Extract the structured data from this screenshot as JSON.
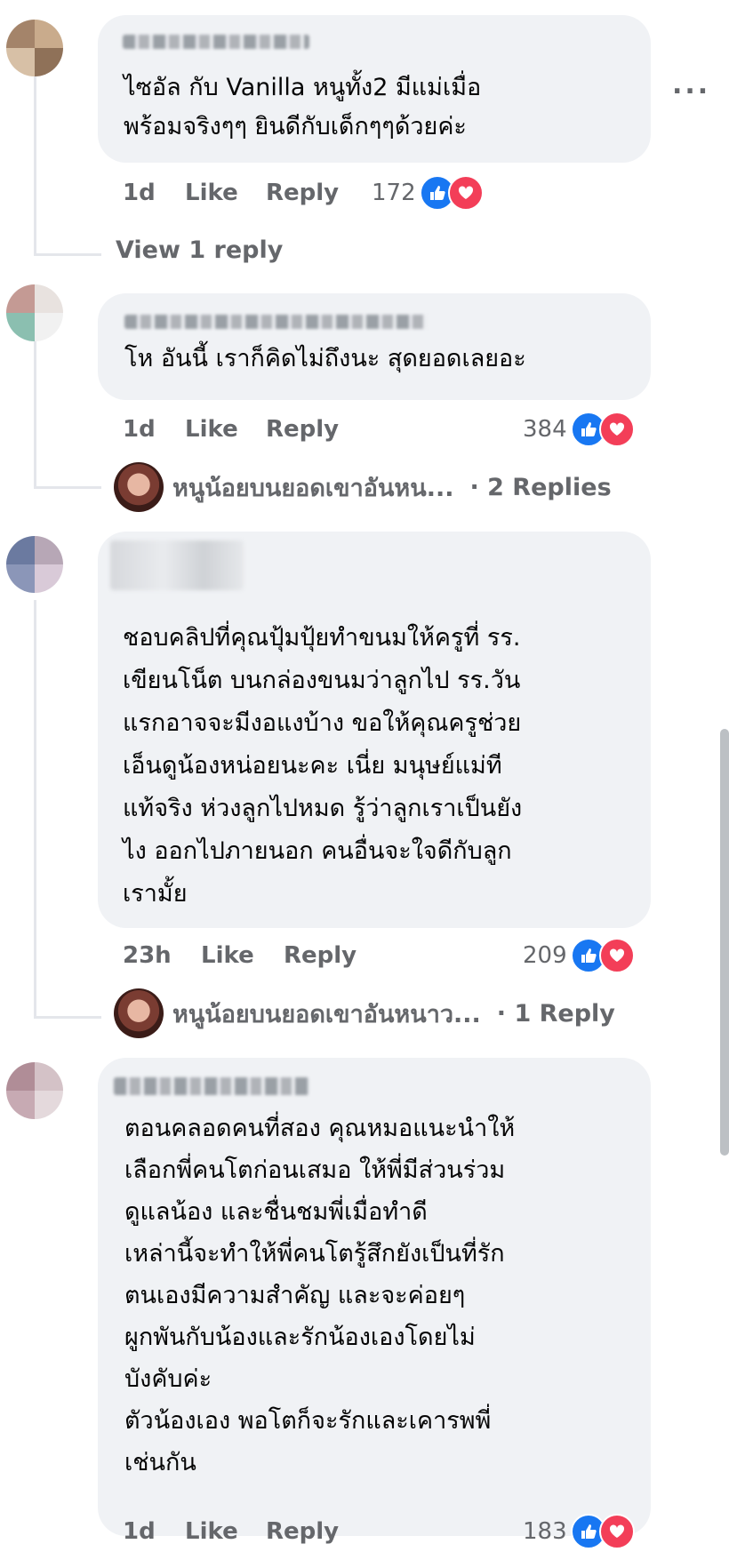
{
  "comments": [
    {
      "text": "ไซอัล กับ Vanilla หนูทั้ง2 มีแม่เมื่อ\nพร้อมจริงๆๆ ยินดีกับเด็กๆๆด้วยค่ะ",
      "time": "1d",
      "like_label": "Like",
      "reply_label": "Reply",
      "reaction_count": "172",
      "more_label": "...",
      "view_replies": "View 1 reply"
    },
    {
      "text": "โห อันนี้ เราก็คิดไม่ถึงนะ สุดยอดเลยอะ",
      "time": "1d",
      "like_label": "Like",
      "reply_label": "Reply",
      "reaction_count": "384",
      "reply_preview": {
        "name": "หนูน้อยบนยอดเขาอันหน...",
        "count": "· 2 Replies"
      }
    },
    {
      "text": "ชอบคลิปที่คุณปุ้มปุ้ยทำขนมให้ครูที่ รร.\nเขียนโน็ต บนกล่องขนมว่าลูกไป รร.วัน\nแรกอาจจะมีงอแงบ้าง ขอให้คุณครูช่วย\nเอ็นดูน้องหน่อยนะคะ เนี่ย มนุษย์แม่ที\nแท้จริง ห่วงลูกไปหมด รู้ว่าลูกเราเป็นยัง\nไง ออกไปภายนอก คนอื่นจะใจดีกับลูก\nเรามั้ย",
      "time": "23h",
      "like_label": "Like",
      "reply_label": "Reply",
      "reaction_count": "209",
      "reply_preview": {
        "name": "หนูน้อยบนยอดเขาอันหนาว...",
        "count": "· 1 Reply"
      }
    },
    {
      "text": "ตอนคลอดคนที่สอง คุณหมอแนะนำให้\nเลือกพี่คนโตก่อนเสมอ ให้พี่มีส่วนร่วม\nดูแลน้อง และชื่นชมพี่เมื่อทำดี\nเหล่านี้จะทำให้พี่คนโตรู้สึกยังเป็นที่รัก\nตนเองมีความสำคัญ และจะค่อยๆ\nผูกพันกับน้องและรักน้องเองโดยไม่\nบังคับค่ะ\nตัวน้องเอง พอโตก็จะรักและเคารพพี่\nเช่นกัน",
      "time": "1d",
      "like_label": "Like",
      "reply_label": "Reply",
      "reaction_count": "183"
    }
  ],
  "icons": {
    "like": "like-reaction-icon",
    "love": "love-reaction-icon"
  },
  "colors": {
    "bubble": "#f0f2f5",
    "like": "#1877f2",
    "love": "#f33e58",
    "meta": "#65676b"
  }
}
